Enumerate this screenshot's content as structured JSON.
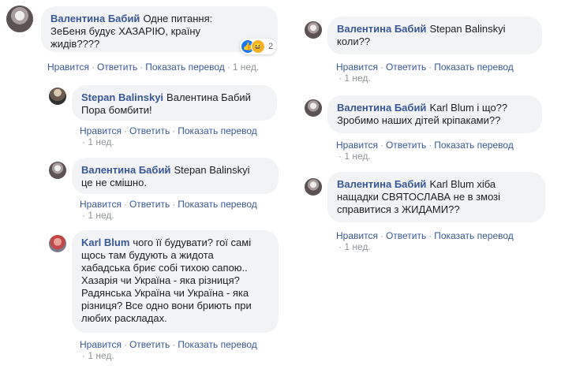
{
  "labels": {
    "like": "Нравится",
    "reply": "Ответить",
    "translate": "Показать перевод",
    "dot": "·"
  },
  "comments": [
    {
      "author": "Валентина Бабий",
      "line1": "Одне питання:",
      "line2": "ЗеБеня будує ХАЗАРІЮ, країну",
      "line3": "жидів????",
      "time": "1 нед.",
      "reactions": {
        "icons": [
          "like-icon",
          "haha-icon"
        ],
        "count": "2"
      }
    },
    {
      "author": "Stepan Balinskyi",
      "line1": "Валентина Бабий",
      "line2": "Пора бомбити!",
      "time": "1 нед."
    },
    {
      "author": "Валентина Бабий",
      "line1": "Stepan Balinskyi",
      "line2": "це не смішно.",
      "time": "1 нед."
    },
    {
      "author": "Karl Blum",
      "line1": "чого її будувати? гої самі",
      "line2": "щось там будують а жидота",
      "line3": "хабадська бриє собі тихою сапою..",
      "line4": "Хазарія чи Україна - яка різниця?",
      "line5": "Радянська Україна чи Україна - яка",
      "line6": "різниця? Все одно вони бриють при",
      "line7": "любих раскладах.",
      "time": "1 нед."
    },
    {
      "author": "Валентина Бабий",
      "line1": "Stepan Balinskyi",
      "line2": "коли??",
      "time": "1 нед."
    },
    {
      "author": "Валентина Бабий",
      "line1": "Karl Blum і що??",
      "line2": "Зробимо наших дітей кріпаками??",
      "time": "1 нед."
    },
    {
      "author": "Валентина Бабий",
      "line1": "Karl Blum хіба",
      "line2": "нащадки СВЯТОСЛАВА не в змозі",
      "line3": "справитися з ЖИДАМИ??",
      "time": "1 нед."
    }
  ]
}
